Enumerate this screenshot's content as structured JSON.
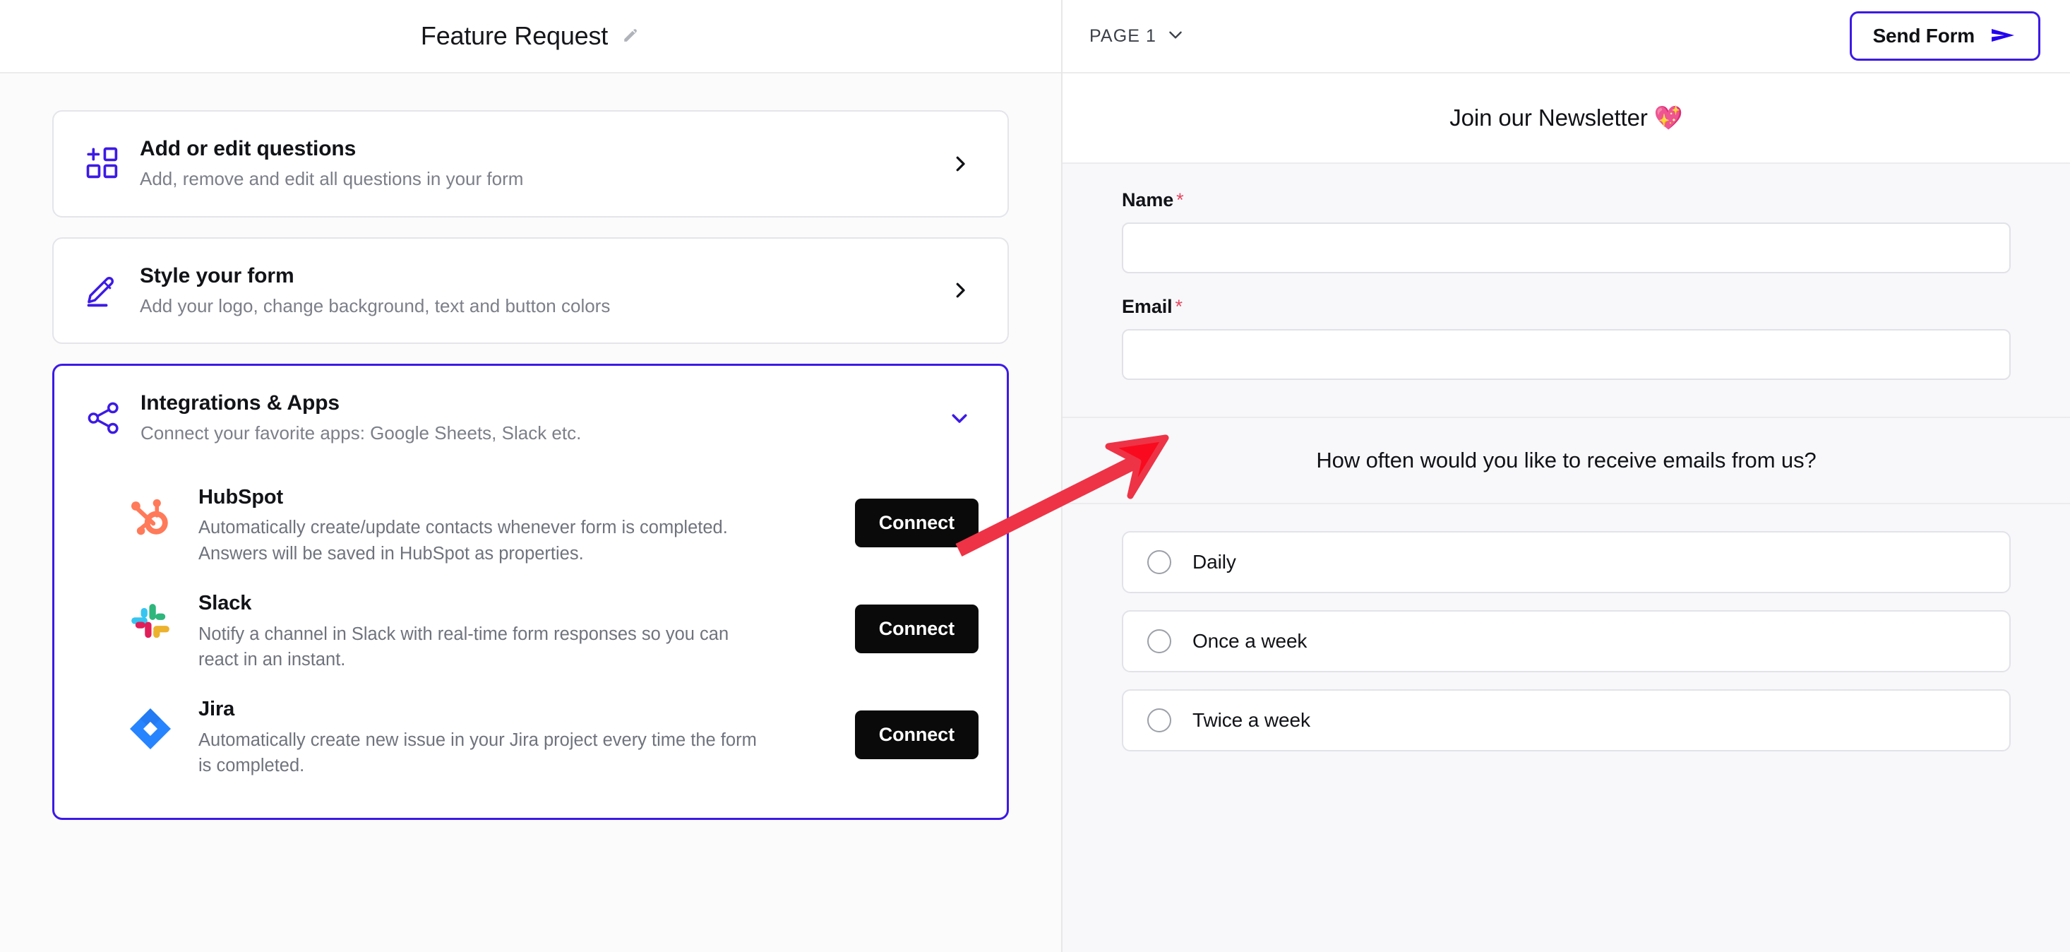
{
  "left": {
    "header": {
      "form_title": "Feature Request",
      "edit_icon": "pencil-icon"
    },
    "cards": [
      {
        "id": "add-edit-questions",
        "icon": "add-grid-icon",
        "title": "Add or edit questions",
        "subtitle": "Add, remove and edit all questions in your form",
        "chevron": "chevron-right-icon",
        "expanded": false
      },
      {
        "id": "style-your-form",
        "icon": "pencil-underline-icon",
        "title": "Style your form",
        "subtitle": "Add your logo, change background, text and button colors",
        "chevron": "chevron-right-icon",
        "expanded": false
      },
      {
        "id": "integrations-apps",
        "icon": "share-network-icon",
        "title": "Integrations & Apps",
        "subtitle": "Connect your favorite apps: Google Sheets, Slack etc.",
        "chevron": "chevron-down-icon",
        "expanded": true
      }
    ],
    "integrations": [
      {
        "id": "hubspot",
        "logo": "hubspot-logo",
        "name": "HubSpot",
        "description": "Automatically create/update contacts whenever form is completed. Answers will be saved in HubSpot as properties.",
        "button_label": "Connect"
      },
      {
        "id": "slack",
        "logo": "slack-logo",
        "name": "Slack",
        "description": "Notify a channel in Slack with real-time form responses so you can react in an instant.",
        "button_label": "Connect"
      },
      {
        "id": "jira",
        "logo": "jira-logo",
        "name": "Jira",
        "description": "Automatically create new issue in your Jira project every time the form is completed.",
        "button_label": "Connect"
      }
    ]
  },
  "right": {
    "header": {
      "page_label": "PAGE 1",
      "page_chevron": "chevron-down-icon",
      "send_form_label": "Send Form",
      "send_icon": "send-paper-plane-icon"
    },
    "preview": {
      "title": "Join our Newsletter 💖",
      "fields": [
        {
          "id": "name",
          "label": "Name",
          "required_marker": "*",
          "value": "",
          "placeholder": ""
        },
        {
          "id": "email",
          "label": "Email",
          "required_marker": "*",
          "value": "",
          "placeholder": ""
        }
      ],
      "question": "How often would you like to receive emails from us?",
      "options": [
        {
          "id": "daily",
          "label": "Daily",
          "selected": false
        },
        {
          "id": "once-a-week",
          "label": "Once a week",
          "selected": false
        },
        {
          "id": "twice-a-week",
          "label": "Twice a week",
          "selected": false
        }
      ]
    }
  },
  "annotation": {
    "arrow_color": "#ee3346",
    "arrow_type": "pointer-arrow"
  },
  "colors": {
    "accent_indigo": "#3d1ae5",
    "required_red": "#e8475f",
    "button_black": "#0a0a0a",
    "hubspot_orange": "#ff7a59",
    "jira_blue": "#2684ff",
    "annotation_red": "#ee3346"
  }
}
